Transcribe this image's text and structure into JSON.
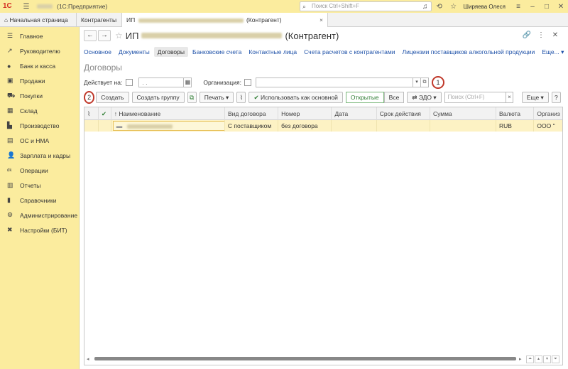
{
  "titlebar": {
    "logo": "1С",
    "app_name": "(1С:Предприятие)",
    "search_placeholder": "Поиск Ctrl+Shift+F",
    "user": "Ширяева Олеся"
  },
  "tabs": [
    {
      "label": "Начальная страница"
    },
    {
      "label": "Контрагенты"
    },
    {
      "label_prefix": "ИП",
      "label_suffix": "(Контрагент)"
    }
  ],
  "sidebar": {
    "items": [
      {
        "label": "Главное",
        "icon": "menu-icon"
      },
      {
        "label": "Руководителю",
        "icon": "trend-icon"
      },
      {
        "label": "Банк и касса",
        "icon": "coins-icon"
      },
      {
        "label": "Продажи",
        "icon": "sales-icon"
      },
      {
        "label": "Покупки",
        "icon": "cart-icon"
      },
      {
        "label": "Склад",
        "icon": "warehouse-icon"
      },
      {
        "label": "Производство",
        "icon": "production-icon"
      },
      {
        "label": "ОС и НМА",
        "icon": "assets-icon"
      },
      {
        "label": "Зарплата и кадры",
        "icon": "person-icon"
      },
      {
        "label": "Операции",
        "icon": "operations-icon"
      },
      {
        "label": "Отчеты",
        "icon": "reports-icon"
      },
      {
        "label": "Справочники",
        "icon": "books-icon"
      },
      {
        "label": "Администрирование",
        "icon": "gear-icon"
      },
      {
        "label": "Настройки (БИТ)",
        "icon": "tools-icon"
      }
    ]
  },
  "form": {
    "title_prefix": "ИП",
    "title_suffix": "(Контрагент)",
    "links": [
      "Основное",
      "Документы",
      "Договоры",
      "Банковские счета",
      "Контактные лица",
      "Счета расчетов с контрагентами",
      "Лицензии поставщиков алкогольной продукции",
      "Еще..."
    ],
    "section_title": "Договоры",
    "filter": {
      "acts_on_label": "Действует на:",
      "date_value": ". .",
      "org_label": "Организация:"
    },
    "callouts": {
      "one": "1",
      "two": "2"
    },
    "toolbar": {
      "create": "Создать",
      "create_group": "Создать группу",
      "print": "Печать",
      "use_main": "Использовать как основной",
      "open": "Открытые",
      "all": "Все",
      "edo": "ЭДО",
      "search_placeholder": "Поиск (Ctrl+F)",
      "more": "Еще",
      "help": "?"
    },
    "table": {
      "columns": [
        "Наименование",
        "Вид договора",
        "Номер",
        "Дата",
        "Срок действия",
        "Сумма",
        "Валюта",
        "Организ"
      ],
      "rows": [
        {
          "name": "",
          "type": "С поставщиком",
          "number": "без договора",
          "date": "",
          "term": "",
          "sum": "",
          "currency": "RUB",
          "org": "ООО \""
        }
      ]
    }
  }
}
